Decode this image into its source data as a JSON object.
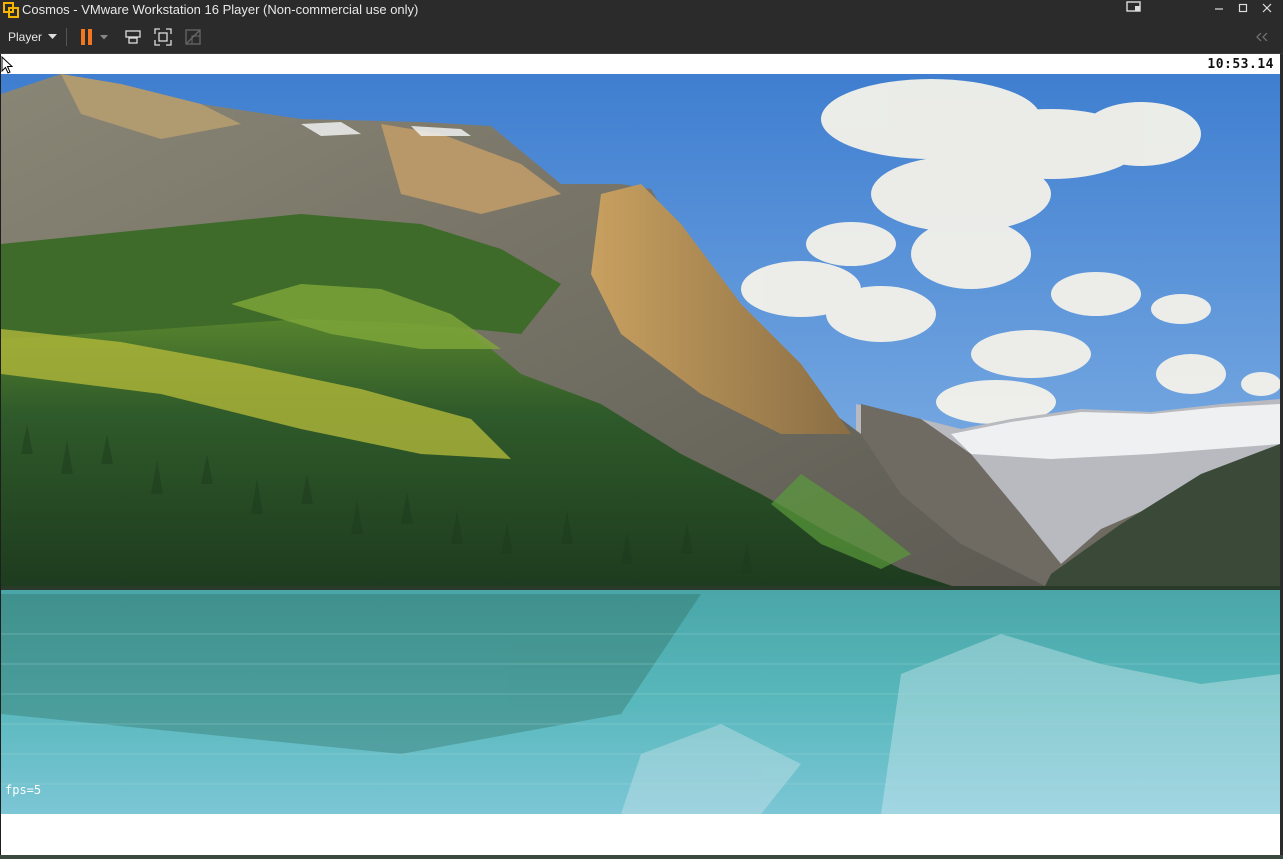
{
  "window": {
    "title": "Cosmos - VMware Workstation 16 Player (Non-commercial use only)",
    "controls": [
      "minimize",
      "maximize",
      "close"
    ]
  },
  "toolbar": {
    "player_label": "Player",
    "buttons": [
      "pause",
      "send-ctrl-alt-del",
      "full-screen",
      "unity"
    ]
  },
  "guest": {
    "clock": "10:53.14",
    "fps_label": "fps=5",
    "wallpaper": "mountain-lake-landscape"
  },
  "colors": {
    "chrome": "#2b2b2b",
    "pause_accent": "#f07822",
    "sky": "#4a88d0",
    "lake": "#4fb0b4",
    "forest": "#2f5a2a"
  }
}
